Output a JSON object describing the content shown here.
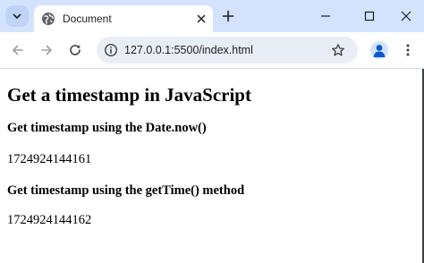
{
  "browser": {
    "tab": {
      "title": "Document"
    },
    "address_bar": {
      "url": "127.0.0.1:5500/index.html"
    },
    "icons": {
      "tab_search": "chevron-down-icon",
      "favicon": "globe-icon",
      "tab_close": "close-icon",
      "new_tab": "plus-icon",
      "minimize": "minimize-icon",
      "maximize": "maximize-icon",
      "close_window": "close-icon",
      "back": "arrow-left-icon",
      "forward": "arrow-right-icon",
      "reload": "reload-icon",
      "site_info": "info-icon",
      "bookmark": "star-icon",
      "profile": "person-icon",
      "menu": "kebab-menu-icon"
    },
    "colors": {
      "tabstrip": "#d3e3fd",
      "omnibox": "#e9eef6",
      "profile": "#0b57d0"
    }
  },
  "page": {
    "heading": "Get a timestamp in JavaScript",
    "section1": {
      "title": "Get timestamp using the Date.now()",
      "value": "1724924144161"
    },
    "section2": {
      "title": "Get timestamp using the getTime() method",
      "value": "1724924144162"
    }
  }
}
